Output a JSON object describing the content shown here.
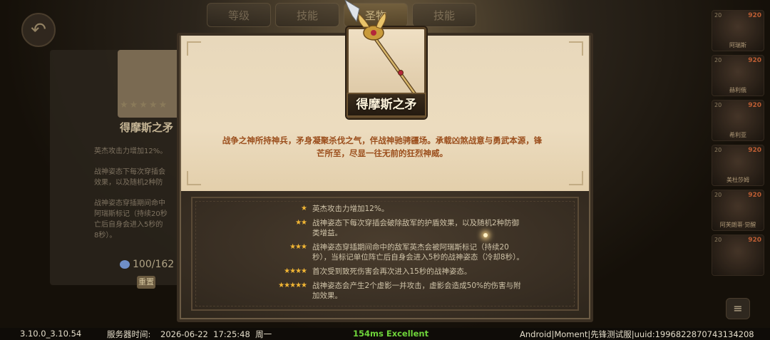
{
  "top_tabs": [
    {
      "label": "等级"
    },
    {
      "label": "技能"
    },
    {
      "label": "圣物"
    },
    {
      "label": "技能"
    }
  ],
  "left_panel": {
    "title": "得摩斯之矛",
    "line1": "英杰攻击力增加12%。",
    "line2": "战神姿态下每次穿插会\n效果，以及随机2种防",
    "line3": "战神姿态穿插期间命中\n阿瑞斯标记（持续20秒\n亡后自身会进入5秒的\n8秒）。",
    "count": "100/162",
    "badge": "重置"
  },
  "modal": {
    "item_name": "得摩斯之矛",
    "lore": "战争之神所持神兵，矛身凝聚杀伐之气，伴战神驰骋疆场。承载凶煞战意与勇武本源，锋芒所至，尽显一往无前的狂烈神威。",
    "effects": [
      {
        "stars": "★",
        "text": "英杰攻击力增加12%。"
      },
      {
        "stars": "★★",
        "text": "战神姿态下每次穿插会破除敌军的护盾效果，以及随机2种防御类增益。"
      },
      {
        "stars": "★★★",
        "text": "战神姿态穿插期间命中的敌军英杰会被阿瑞斯标记（持续20秒），当标记单位阵亡后自身会进入5秒的战神姿态（冷却8秒）。"
      },
      {
        "stars": "★★★★",
        "text": "首次受到致死伤害会再次进入15秒的战神姿态。"
      },
      {
        "stars": "★★★★★",
        "text": "战神姿态会产生2个虚影一并攻击，虚影会造成50%的伤害与附加效果。"
      }
    ]
  },
  "hero_list": [
    {
      "power": "920",
      "level": "20",
      "name": "阿瑞斯"
    },
    {
      "power": "920",
      "level": "20",
      "name": "赫利俄"
    },
    {
      "power": "920",
      "level": "20",
      "name": "希利亚"
    },
    {
      "power": "920",
      "level": "20",
      "name": "美杜莎姆"
    },
    {
      "power": "920",
      "level": "20",
      "name": "阿芙朗蒂·觉醒"
    },
    {
      "power": "920",
      "level": "20",
      "name": ""
    }
  ],
  "status_bar": {
    "version": "3.10.0_3.10.54",
    "server_time_label": "服务器时间:",
    "server_time": "2026-06-22  17:25:48  周一",
    "ping": "154ms Excellent",
    "device": "Android|Moment|先锋测试服|uuid:1996822870743134208"
  },
  "colors": {
    "lore": "#9b4e1c",
    "star": "#f2b634",
    "ping": "#6ed43a"
  }
}
